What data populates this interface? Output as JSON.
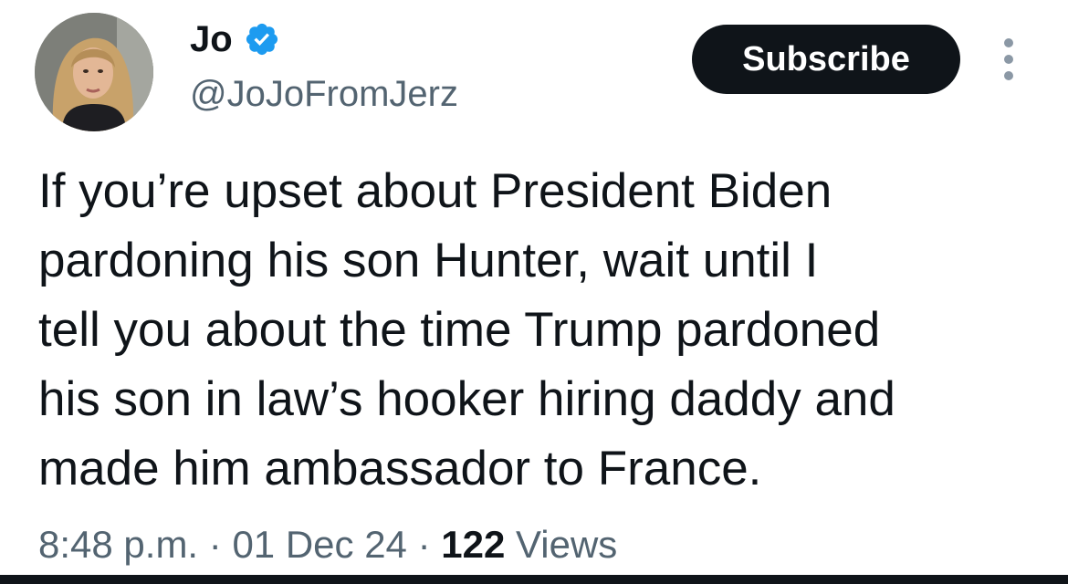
{
  "author": {
    "display_name": "Jo",
    "handle": "@JoJoFromJerz",
    "verified_icon": "verified-badge-icon",
    "verified_color": "#1d9bf0"
  },
  "actions": {
    "subscribe_label": "Subscribe",
    "more_icon": "more-options-icon"
  },
  "tweet": {
    "lines": [
      "If you’re upset about President Biden",
      "pardoning his son Hunter, wait until I",
      "tell you about the time Trump pardoned",
      "his son in law’s hooker hiring daddy and",
      "made him ambassador to France."
    ]
  },
  "meta": {
    "time": "8:48 p.m.",
    "separator": "·",
    "date": "01 Dec 24",
    "views_count": "122",
    "views_label": "Views"
  },
  "colors": {
    "text": "#0f1419",
    "secondary": "#536471",
    "button_bg": "#0f1419",
    "button_text": "#ffffff"
  }
}
